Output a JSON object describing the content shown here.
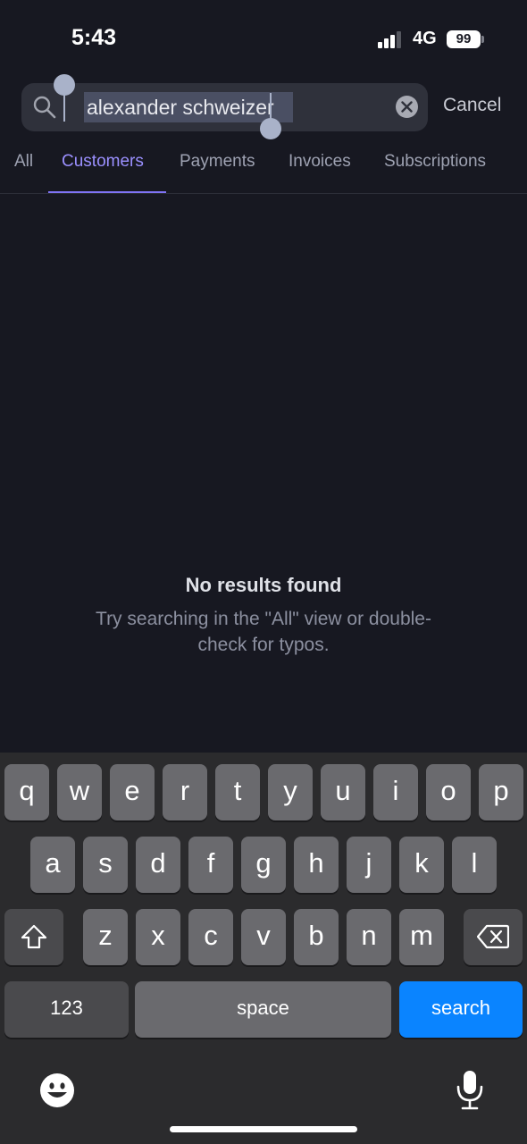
{
  "status": {
    "time": "5:43",
    "network": "4G",
    "battery": "99"
  },
  "search": {
    "query": "alexander schweizer",
    "cancel_label": "Cancel"
  },
  "tabs": [
    {
      "label": "All"
    },
    {
      "label": "Customers"
    },
    {
      "label": "Payments"
    },
    {
      "label": "Invoices"
    },
    {
      "label": "Subscriptions"
    }
  ],
  "empty_state": {
    "title": "No results found",
    "body": "Try searching in the \"All\" view or double-check for typos."
  },
  "keyboard": {
    "row1": [
      "q",
      "w",
      "e",
      "r",
      "t",
      "y",
      "u",
      "i",
      "o",
      "p"
    ],
    "row2": [
      "a",
      "s",
      "d",
      "f",
      "g",
      "h",
      "j",
      "k",
      "l"
    ],
    "row3": [
      "z",
      "x",
      "c",
      "v",
      "b",
      "n",
      "m"
    ],
    "numbers_label": "123",
    "space_label": "space",
    "search_label": "search"
  },
  "colors": {
    "accent": "#9b90ff",
    "search_key": "#0a84ff",
    "background": "#171821"
  },
  "icons": {
    "search": "search-icon",
    "clear": "clear-icon",
    "shift": "shift-icon",
    "backspace": "backspace-icon",
    "emoji": "emoji-icon",
    "mic": "microphone-icon"
  }
}
